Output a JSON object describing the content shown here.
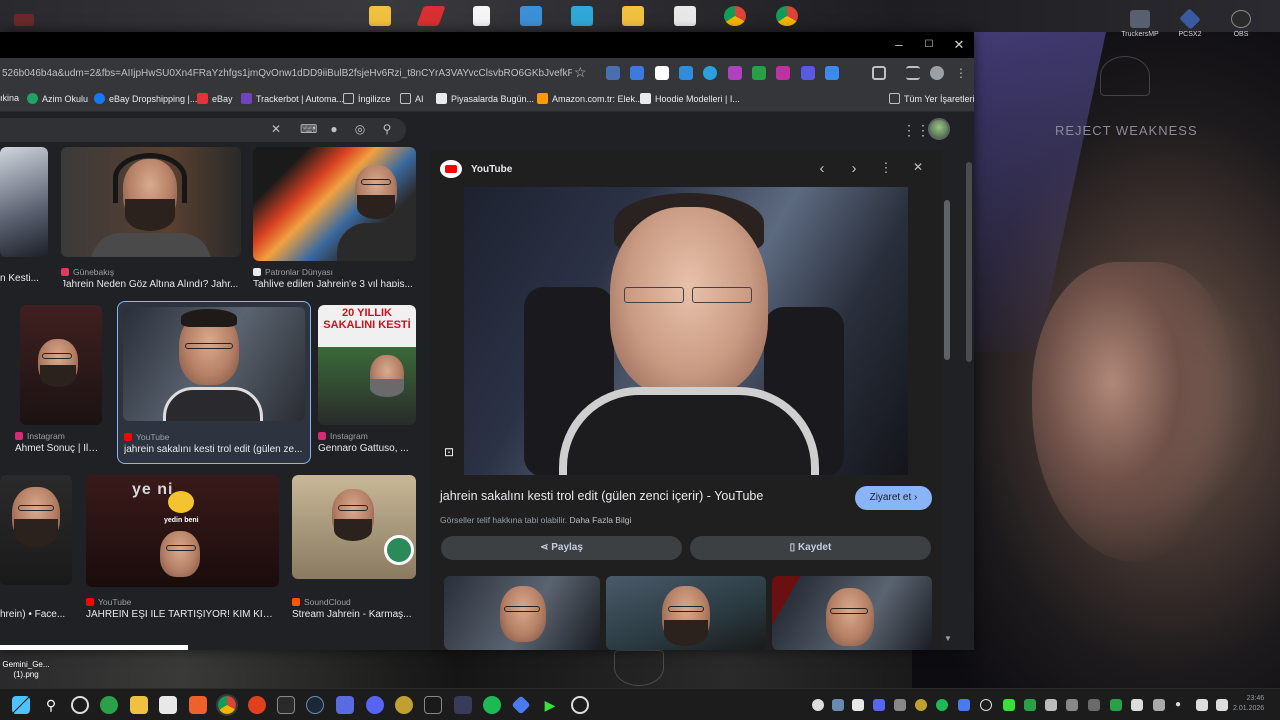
{
  "desktop": {
    "motto": "REJECT WEAKNESS",
    "tray_apps": [
      {
        "label": "TruckersMP"
      },
      {
        "label": "PCSX2"
      },
      {
        "label": "OBS"
      }
    ],
    "file_label": "Gemini_Ge... (1).png"
  },
  "browser": {
    "url": "526b046b4a&udm=2&fbs=AIIjpHwSU0Xn4FRaYzhfgs1jmQvOnw1dDD9iiBulB2fsjeHv6Rzi_t8nCYrA3VAYvcClsvbRO6GKbJvefkP9HMXaSG...",
    "bookmarks": [
      {
        "label": "ıkina",
        "color": "#4285f4"
      },
      {
        "label": "Azim Okulu",
        "color": "#1ea362"
      },
      {
        "label": "eBay Dropshipping |...",
        "color": "#1877f2"
      },
      {
        "label": "eBay",
        "color": "#e53238"
      },
      {
        "label": "Trackerbot | Automa...",
        "color": "#6f42c1"
      },
      {
        "label": "İngilizce",
        "color": "#bdc1c6"
      },
      {
        "label": "AI",
        "color": "#bdc1c6"
      },
      {
        "label": "Piyasalarda Bugün...",
        "color": "#e8eaed"
      },
      {
        "label": "Amazon.com.tr: Elek...",
        "color": "#ff9900"
      },
      {
        "label": "Hoodie Modelleri | I...",
        "color": "#e8eaed"
      },
      {
        "label": "Tüm Yer İşaretleri",
        "color": "#bdc1c6"
      }
    ]
  },
  "results": {
    "row1": [
      {
        "source": "",
        "caption": "n Kesti..."
      },
      {
        "source": "Günebakış",
        "caption": "Jahrein Neden Göz Altına Alındı? Jahr..."
      },
      {
        "source": "Patronlar Dünyası",
        "caption": "Tahliye edilen Jahrein'e 3 yıl hapis..."
      }
    ],
    "row2": [
      {
        "source": "Instagram",
        "caption": "Ahmet Sonuç | İlk ..."
      },
      {
        "source": "YouTube",
        "caption": "jahrein sakalını kesti trol edit (gülen ze..."
      },
      {
        "source": "Instagram",
        "caption": "Gennaro Gattuso, ..."
      }
    ],
    "row3": [
      {
        "source": "",
        "caption": "hrein) • Face..."
      },
      {
        "source": "YouTube",
        "caption": "JAHREIN EŞİ İLE TARTIŞIYOR! KİM KİM..."
      },
      {
        "source": "SoundCloud",
        "caption": "Stream Jahrein - Karmaş..."
      }
    ],
    "overlay_text": {
      "twenty_years": "20 YILLIK SAKALINI KESTİ",
      "yedin": "ye     ni",
      "yedin_small": "yedin beni"
    }
  },
  "preview": {
    "site": "YouTube",
    "title": "jahrein sakalını kesti trol edit (gülen zenci içerir) - YouTube",
    "note": "Görseller telif hakkına tabi olabilir.",
    "note_link": "Daha Fazla Bilgi",
    "visit": "Ziyaret et",
    "share": "Paylaş",
    "save": "Kaydet"
  },
  "clock": {
    "time": "23:46",
    "date": "2.01.2026"
  },
  "colors": {
    "accent": "#8ab4f8",
    "panel": "#1f1f1f",
    "background": "#202124"
  }
}
